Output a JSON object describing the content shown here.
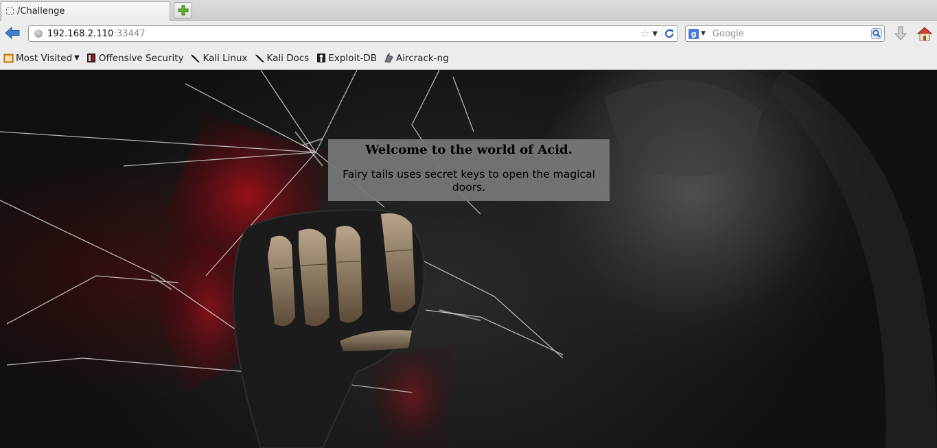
{
  "browser": {
    "tab": {
      "title": "/Challenge"
    },
    "url": {
      "host": "192.168.2.110",
      "port": ":33447"
    },
    "search": {
      "engine_letter": "g",
      "placeholder": "Google"
    },
    "bookmarks": [
      {
        "label": "Most Visited",
        "icon": "most-visited-icon"
      },
      {
        "label": "Offensive Security",
        "icon": "offensive-security-icon"
      },
      {
        "label": "Kali Linux",
        "icon": "kali-dragon-icon"
      },
      {
        "label": "Kali Docs",
        "icon": "kali-dragon-icon"
      },
      {
        "label": "Exploit-DB",
        "icon": "exploit-db-icon"
      },
      {
        "label": "Aircrack-ng",
        "icon": "aircrack-icon"
      }
    ]
  },
  "page": {
    "heading": "Welcome to the world of Acid.",
    "text": "Fairy tails uses secret keys to open the magical doors."
  },
  "colors": {
    "chrome": "#ececec",
    "accent_red": "#b0101a",
    "box_gray": "#787878"
  }
}
